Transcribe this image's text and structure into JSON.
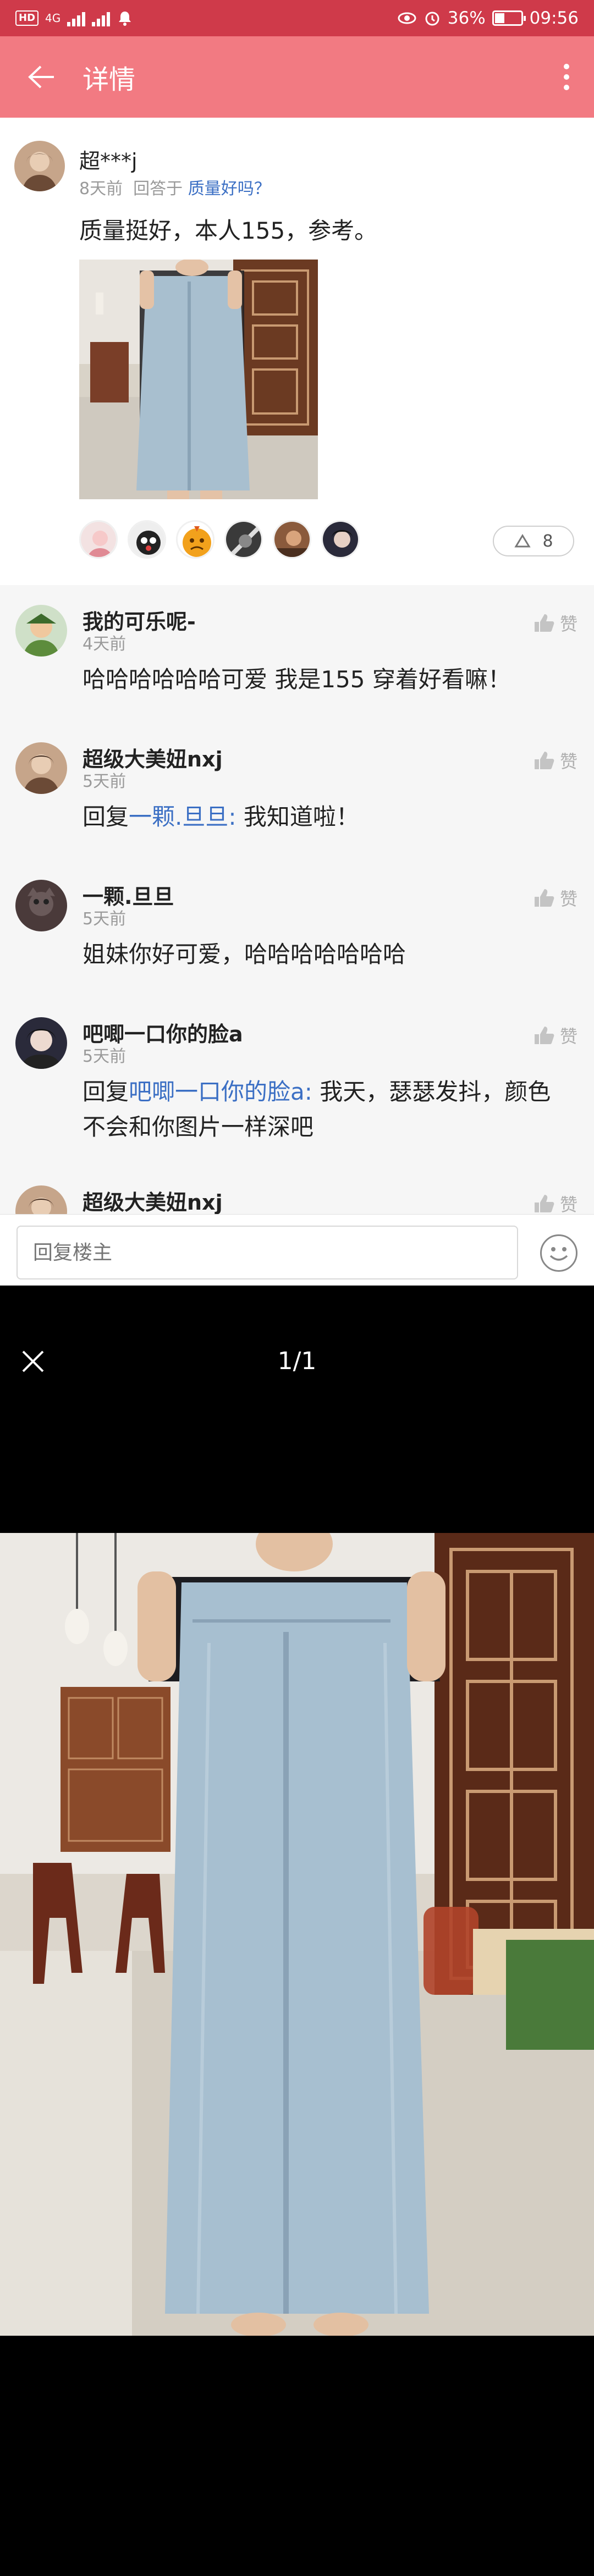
{
  "status_bar": {
    "network_badge": "HD",
    "signal_label": "4G",
    "battery_percent": "36%",
    "battery_level": 0.36,
    "time": "09:56"
  },
  "app_bar": {
    "back_icon": "arrow-left-icon",
    "title": "详情",
    "more_icon": "more-vert-icon"
  },
  "main_post": {
    "author": "超***j",
    "time": "8天前",
    "answer_prefix": "回答于",
    "question": "质量好吗？",
    "text": "质量挺好，本人155，参考。",
    "like_icon": "thumb-up-outline-icon",
    "like_count": "8"
  },
  "comments": [
    {
      "author": "我的可乐呢-",
      "time": "4天前",
      "reply_prefix": "",
      "reply_to": "",
      "text": "哈哈哈哈哈哈可爱 我是155 穿着好看嘛！",
      "like_label": "赞"
    },
    {
      "author": "超级大美妞nxj",
      "time": "5天前",
      "reply_prefix": "回复",
      "reply_to": "一颗.旦旦:",
      "text": " 我知道啦！",
      "like_label": "赞"
    },
    {
      "author": "一颗.旦旦",
      "time": "5天前",
      "reply_prefix": "",
      "reply_to": "",
      "text": "姐妹你好可爱，哈哈哈哈哈哈哈",
      "like_label": "赞"
    },
    {
      "author": "吧唧一口你的脸a",
      "time": "5天前",
      "reply_prefix": "回复",
      "reply_to": "吧唧一口你的脸a:",
      "text": " 我天，瑟瑟发抖，颜色不会和你图片一样深吧",
      "like_label": "赞"
    },
    {
      "author": "超级大美妞nxj",
      "time": "",
      "reply_prefix": "",
      "reply_to": "",
      "text": "",
      "like_label": "赞"
    }
  ],
  "reply_bar": {
    "placeholder": "回复楼主",
    "emoji_icon": "smiley-face-icon"
  },
  "viewer": {
    "close_icon": "close-x-icon",
    "counter": "1/1"
  },
  "colors": {
    "status_bar": "#cf3a4a",
    "app_bar": "#f27a82",
    "link": "#3b6fc4",
    "comment_bg": "#f6f6f6"
  }
}
